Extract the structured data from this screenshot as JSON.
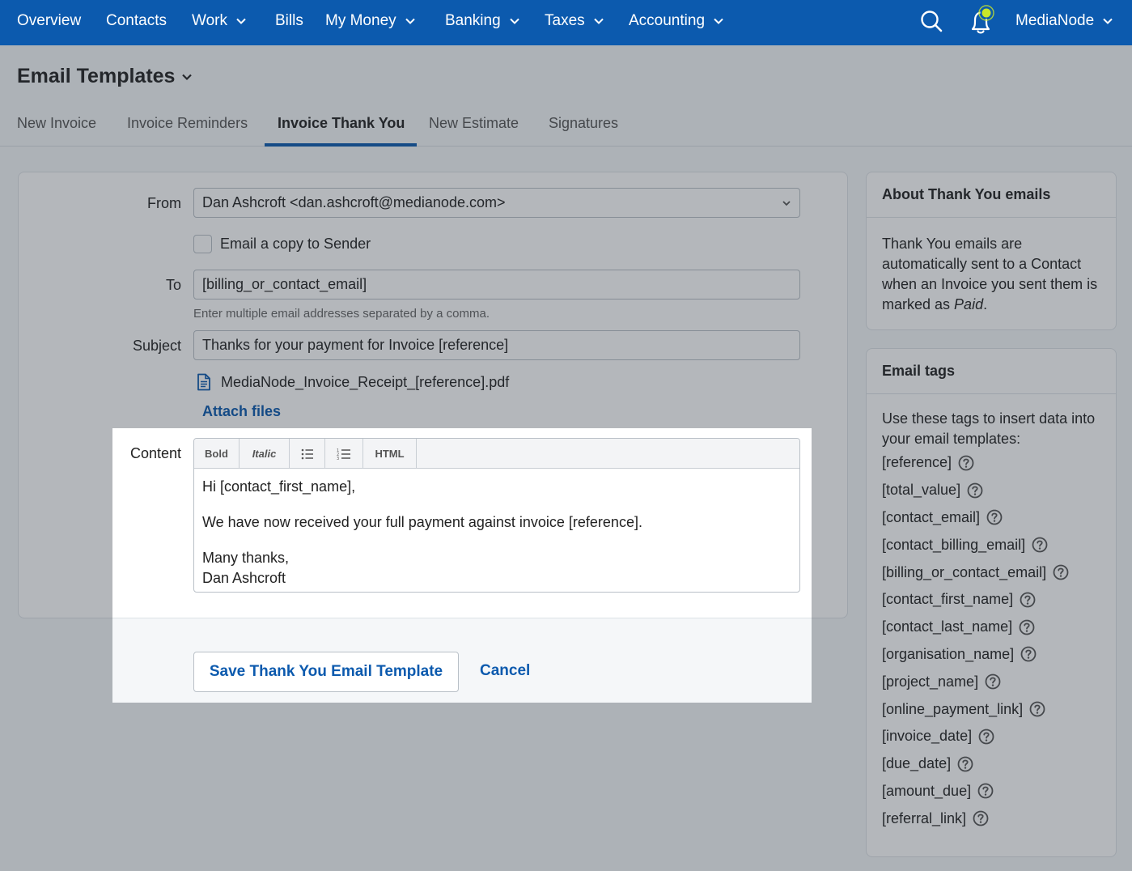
{
  "topnav": {
    "items": [
      {
        "label": "Overview",
        "dropdown": false
      },
      {
        "label": "Contacts",
        "dropdown": false
      },
      {
        "label": "Work",
        "dropdown": true
      },
      {
        "label": "Bills",
        "dropdown": false
      },
      {
        "label": "My Money",
        "dropdown": true
      },
      {
        "label": "Banking",
        "dropdown": true
      },
      {
        "label": "Taxes",
        "dropdown": true
      },
      {
        "label": "Accounting",
        "dropdown": true
      }
    ],
    "account_label": "MediaNode",
    "icons": {
      "search": "search-icon",
      "notifications": "bell-icon"
    },
    "colors": {
      "bar": "#0c5aae",
      "notification_dot": "#c8e62a"
    }
  },
  "page": {
    "title": "Email Templates",
    "tabs": [
      {
        "label": "New Invoice",
        "active": false
      },
      {
        "label": "Invoice Reminders",
        "active": false
      },
      {
        "label": "Invoice Thank You",
        "active": true
      },
      {
        "label": "New Estimate",
        "active": false
      },
      {
        "label": "Signatures",
        "active": false
      }
    ]
  },
  "form": {
    "from_label": "From",
    "from_value": "Dan Ashcroft <dan.ashcroft@medianode.com>",
    "copy_checkbox_label": "Email a copy to Sender",
    "copy_checked": false,
    "to_label": "To",
    "to_value": "[billing_or_contact_email]",
    "to_hint": "Enter multiple email addresses separated by a comma.",
    "subject_label": "Subject",
    "subject_value": "Thanks for your payment for Invoice [reference]",
    "attachment_name": "MediaNode_Invoice_Receipt_[reference].pdf",
    "attach_files_label": "Attach files",
    "content_label": "Content",
    "toolbar": {
      "bold": "Bold",
      "italic": "Italic",
      "html": "HTML"
    },
    "content": {
      "line1": "Hi [contact_first_name],",
      "line2": "We have now received your full payment against invoice [reference].",
      "line3": "Many thanks,",
      "line4": "Dan Ashcroft"
    },
    "save_label": "Save Thank You Email Template",
    "cancel_label": "Cancel"
  },
  "sidebar": {
    "about": {
      "title": "About Thank You emails",
      "text_before": "Thank You emails are automatically sent to a Contact when an Invoice you sent them is marked as ",
      "text_emphasis": "Paid",
      "text_after": "."
    },
    "tags": {
      "title": "Email tags",
      "intro": "Use these tags to insert data into your email templates:",
      "items": [
        "[reference]",
        "[total_value]",
        "[contact_email]",
        "[contact_billing_email]",
        "[billing_or_contact_email]",
        "[contact_first_name]",
        "[contact_last_name]",
        "[organisation_name]",
        "[project_name]",
        "[online_payment_link]",
        "[invoice_date]",
        "[due_date]",
        "[amount_due]",
        "[referral_link]"
      ]
    }
  }
}
